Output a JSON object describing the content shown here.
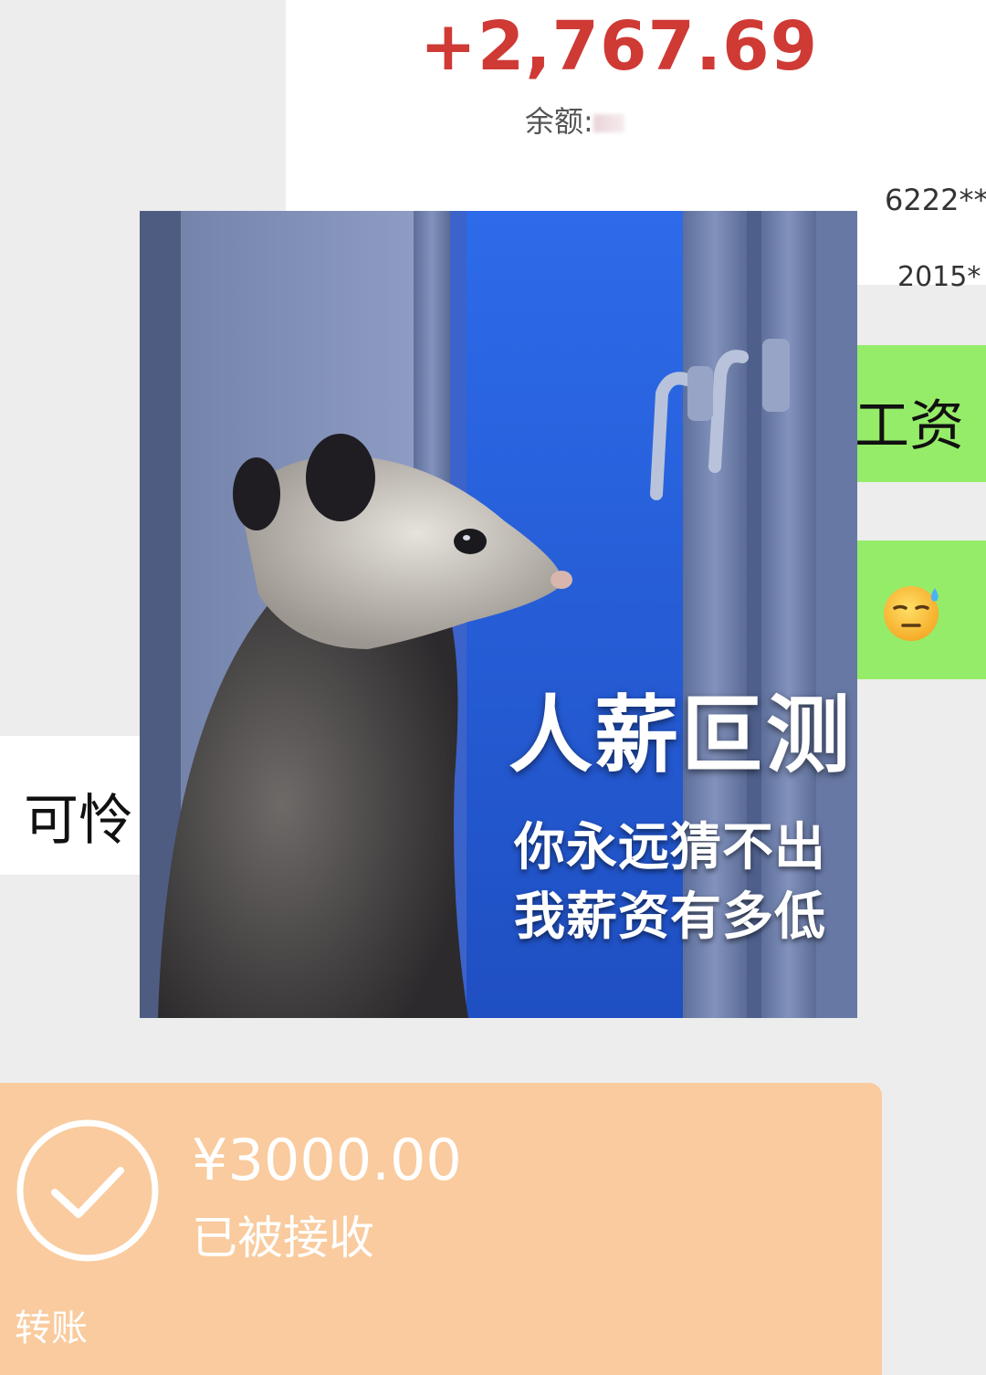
{
  "bank_notice": {
    "amount": "+2,767.69",
    "balance_label": "余额:",
    "card_number": "6222**",
    "date": "2015*"
  },
  "messages": {
    "sent_salary": "工资",
    "sent_emoji_name": "downcast-face-with-sweat-icon",
    "received_text": "可怜"
  },
  "meme": {
    "title": "人薪叵测",
    "line1": "你永远猜不出",
    "line2": "我薪资有多低"
  },
  "transfer": {
    "amount": "¥3000.00",
    "status": "已被接收",
    "label": "转账",
    "icon": "check-circle-icon"
  },
  "colors": {
    "chat_background": "#ededed",
    "sent_bubble": "#95ec69",
    "received_bubble": "#ffffff",
    "amount_red": "#cf3a35",
    "transfer_card": "#f9cb9e"
  }
}
